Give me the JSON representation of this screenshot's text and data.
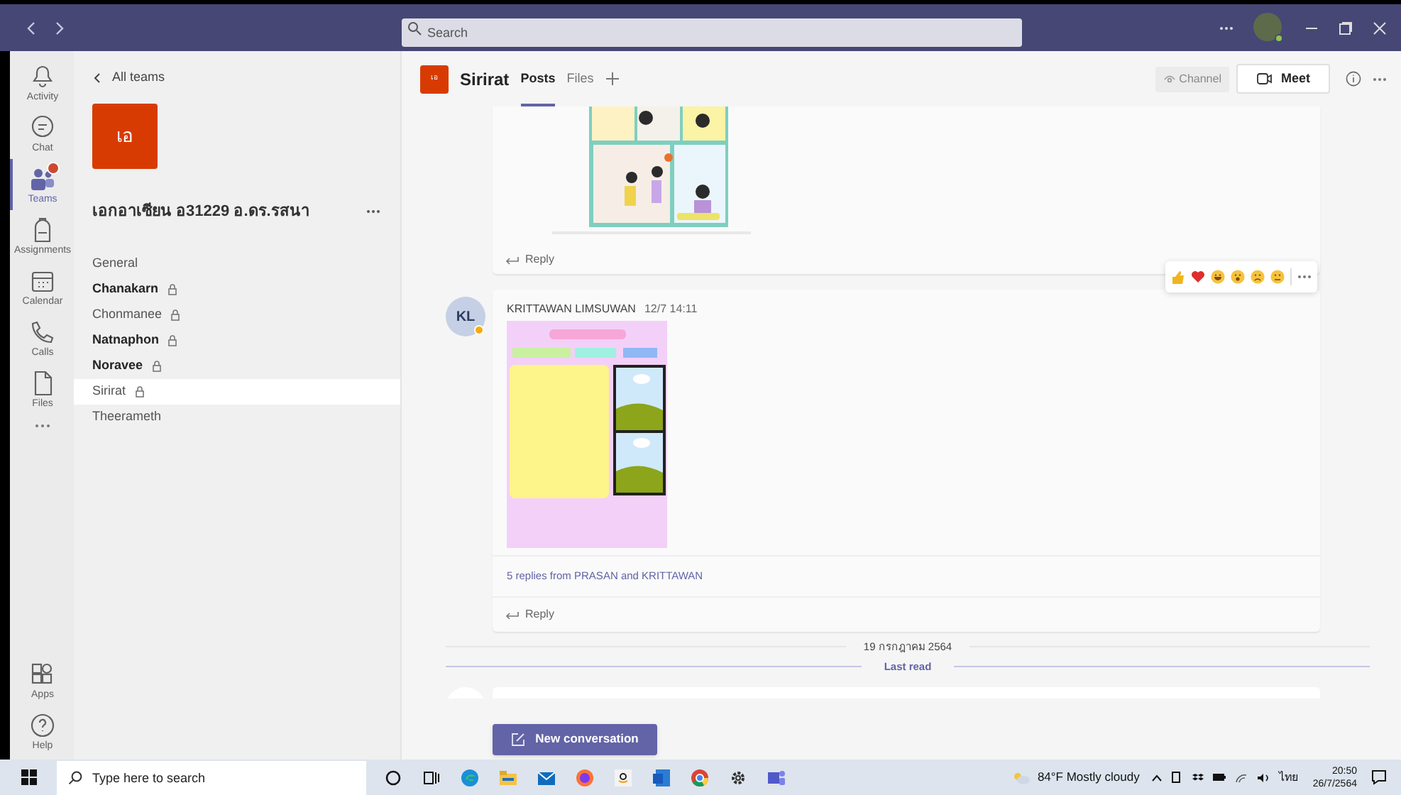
{
  "titlebar": {
    "search": {
      "placeholder": "Search"
    }
  },
  "rail": [
    {
      "label": "Activity",
      "kind": "bell",
      "selected": false,
      "badge": false
    },
    {
      "label": "Chat",
      "kind": "chat",
      "selected": false,
      "badge": false
    },
    {
      "label": "Teams",
      "kind": "teams",
      "selected": true,
      "badge": true
    },
    {
      "label": "Assignments",
      "kind": "bag",
      "selected": false,
      "badge": false
    },
    {
      "label": "Calendar",
      "kind": "calendar",
      "selected": false,
      "badge": false
    },
    {
      "label": "Calls",
      "kind": "phone",
      "selected": false,
      "badge": false
    },
    {
      "label": "Files",
      "kind": "file",
      "selected": false,
      "badge": false
    }
  ],
  "rail_bottom": [
    {
      "label": "Apps",
      "kind": "apps"
    },
    {
      "label": "Help",
      "kind": "help"
    }
  ],
  "team": {
    "back_label": "All teams",
    "tile": "เอ",
    "name": "เอกอาเซียน อ31229 อ.ดร.รสนา"
  },
  "channels": [
    {
      "name": "General",
      "unread": false,
      "locked": false,
      "selected": false
    },
    {
      "name": "Chanakarn",
      "unread": true,
      "locked": true,
      "selected": false
    },
    {
      "name": "Chonmanee",
      "unread": false,
      "locked": true,
      "selected": false
    },
    {
      "name": "Natnaphon",
      "unread": true,
      "locked": true,
      "selected": false
    },
    {
      "name": "Noravee",
      "unread": true,
      "locked": true,
      "selected": false
    },
    {
      "name": "Sirirat",
      "unread": false,
      "locked": true,
      "selected": true
    },
    {
      "name": "Theerameth",
      "unread": false,
      "locked": false,
      "selected": false
    }
  ],
  "header": {
    "tile": "เอ",
    "channel": "Sirirat",
    "tabs": [
      {
        "label": "Posts",
        "selected": true
      },
      {
        "label": "Files",
        "selected": false
      }
    ],
    "channel_button": "Channel",
    "meet_button": "Meet"
  },
  "posts": [
    {
      "kind": "continued",
      "reply": "Reply"
    },
    {
      "kind": "message",
      "initials": "KL",
      "away": true,
      "author": "KRITTAWAN LIMSUWAN",
      "time": "12/7 14:11",
      "replies_summary": "5 replies from PRASAN and KRITTAWAN",
      "reply": "Reply"
    }
  ],
  "date_divider": "19 กรกฎาคม 2564",
  "last_read": "Last read",
  "new_conversation": "New conversation",
  "taskbar": {
    "search_placeholder": "Type here to search",
    "weather": "84°F Mostly cloudy",
    "language": "ไทย",
    "time": "20:50",
    "date": "26/7/2564"
  }
}
